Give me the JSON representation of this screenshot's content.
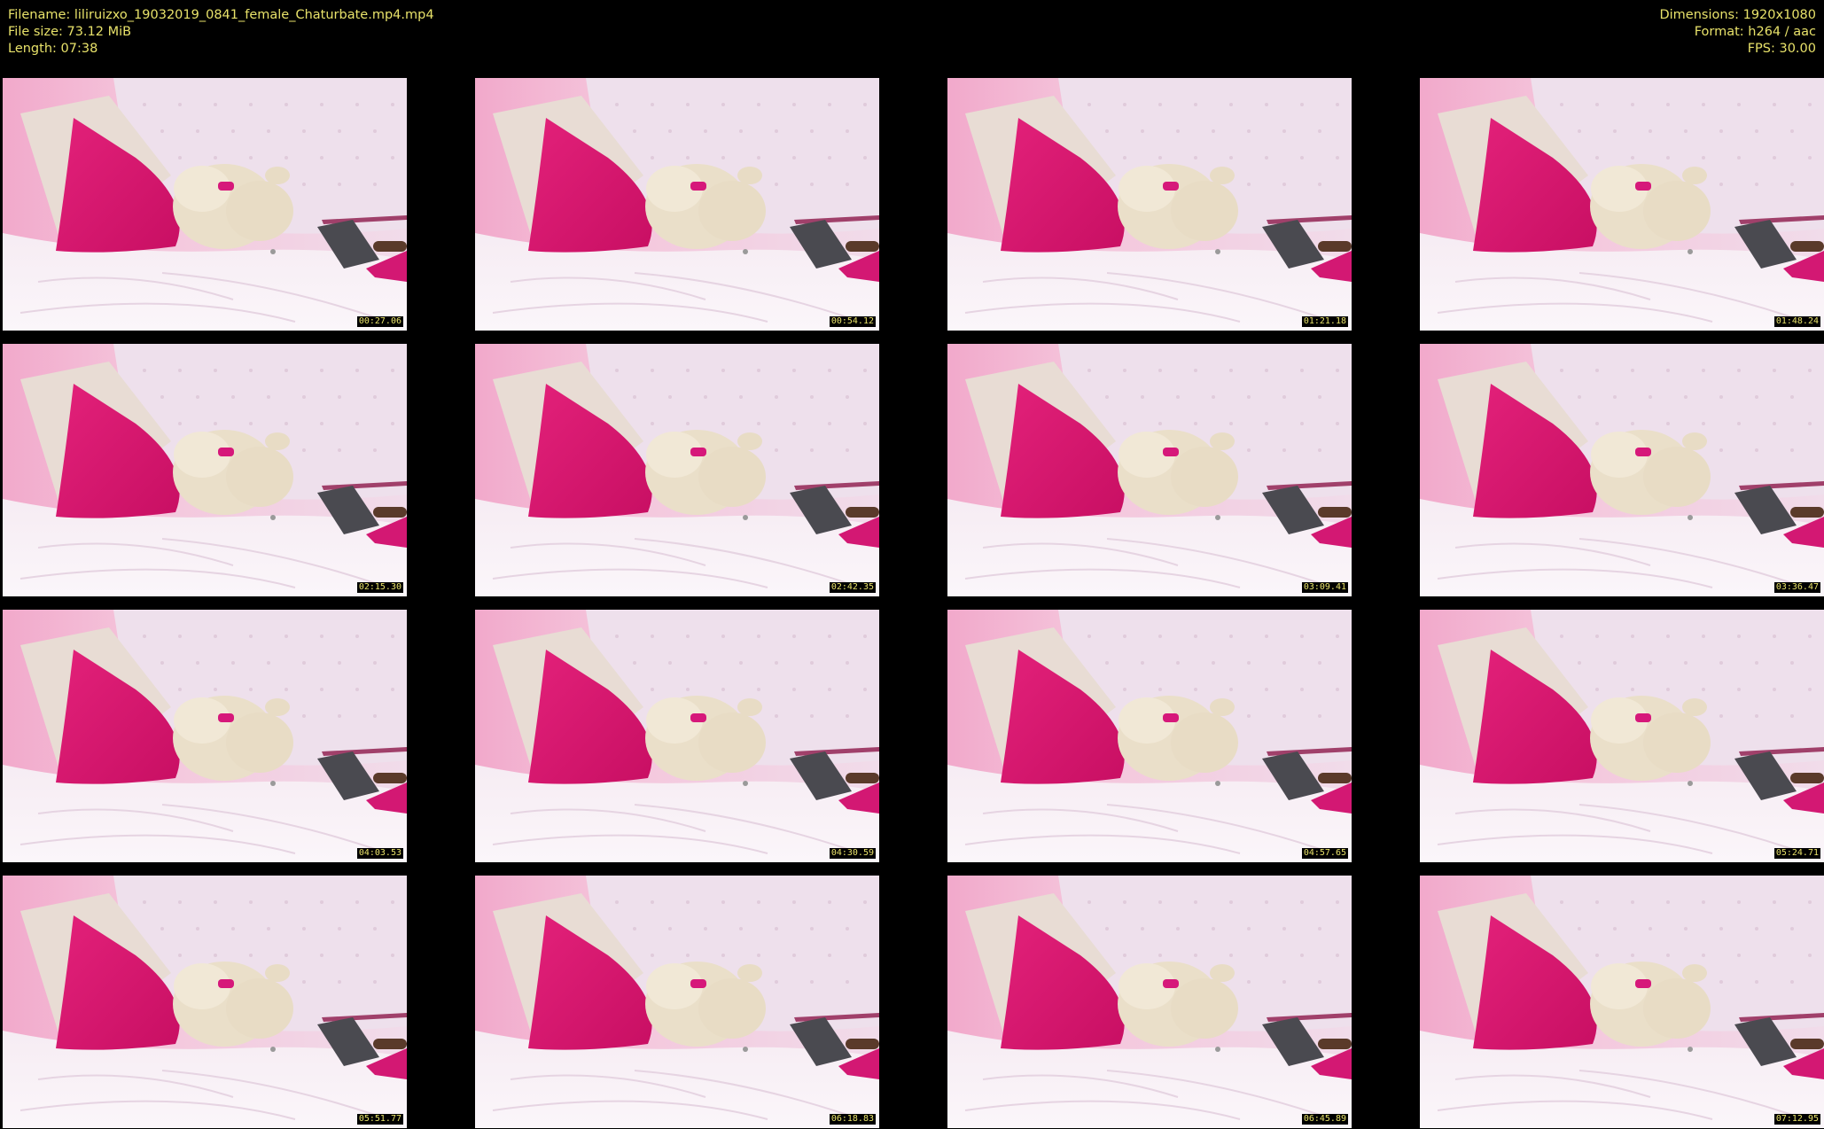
{
  "header": {
    "filename": "Filename: liliruizxo_19032019_0841_female_Chaturbate.mp4.mp4",
    "file_size": "File size: 73.12 MiB",
    "length": "Length: 07:38",
    "dimensions": "Dimensions: 1920x1080",
    "format": "Format: h264 / aac",
    "fps": "FPS: 30.00"
  },
  "thumbnails": [
    {
      "timestamp": "00:27.06"
    },
    {
      "timestamp": "00:54.12"
    },
    {
      "timestamp": "01:21.18"
    },
    {
      "timestamp": "01:48.24"
    },
    {
      "timestamp": "02:15.30"
    },
    {
      "timestamp": "02:42.35"
    },
    {
      "timestamp": "03:09.41"
    },
    {
      "timestamp": "03:36.47"
    },
    {
      "timestamp": "04:03.53"
    },
    {
      "timestamp": "04:30.59"
    },
    {
      "timestamp": "04:57.65"
    },
    {
      "timestamp": "05:24.71"
    },
    {
      "timestamp": "05:51.77"
    },
    {
      "timestamp": "06:18.83"
    },
    {
      "timestamp": "06:45.89"
    },
    {
      "timestamp": "07:12.95"
    }
  ]
}
